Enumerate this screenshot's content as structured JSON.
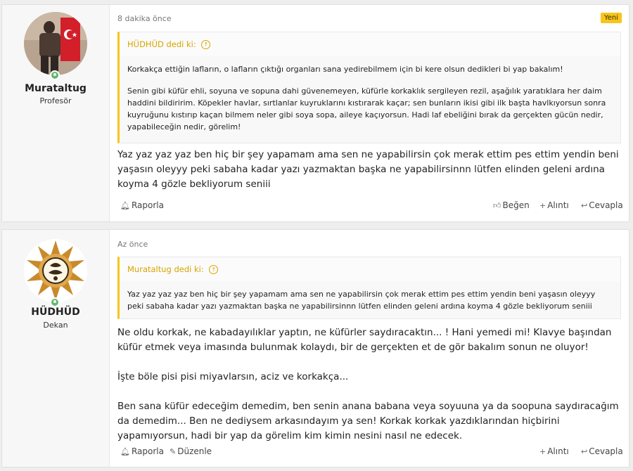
{
  "posts": [
    {
      "user": {
        "name": "Murataltug",
        "title": "Profesör",
        "avatar_icon": "avatar-flag-photo",
        "online": true
      },
      "time": "8 dakika önce",
      "badge": "Yeni",
      "quote": {
        "author": "HÜDHÜD dedi ki:",
        "paragraphs": [
          "Korkakça ettiğin lafların, o lafların çıktığı organları sana yedirebilmem için bi kere olsun dedikleri bi yap bakalım!",
          "Senin gibi küfür ehli, soyuna ve sopuna dahi güvenemeyen, küfürle korkaklık sergileyen rezil, aşağılık yaratıklara her daim haddini bildiririm. Köpekler havlar, sırtlanlar kuyruklarını kıstırarak kaçar; sen bunların ikisi gibi ilk başta havlkıyorsun sonra kuyruğunu kıstırıp kaçan bilmem neler gibi soya sopa, aileye kaçıyorsun. Hadi laf ebeliğini bırak da gerçekten gücün nedir, yapabileceğin nedir, görelim!"
        ]
      },
      "message": [
        "Yaz yaz yaz yaz ben hiç bir şey yapamam ama sen ne yapabilirsin çok merak ettim pes ettim yendin beni yaşasın oleyyy peki sabaha kadar yazı yazmaktan başka ne yapabilirsinnn lütfen elinden geleni ardına koyma 4 gözle bekliyorum seniii"
      ],
      "actions": {
        "report": "Raporla",
        "like": "Beğen",
        "quote": "Alıntı",
        "reply": "Cevapla"
      }
    },
    {
      "user": {
        "name": "HÜDHÜD",
        "title": "Dekan",
        "avatar_icon": "avatar-emblem",
        "online": true
      },
      "time": "Az önce",
      "quote": {
        "author": "Murataltug dedi ki:",
        "paragraphs": [
          "Yaz yaz yaz yaz ben hiç bir şey yapamam ama sen ne yapabilirsin çok merak ettim pes ettim yendin beni yaşasın oleyyy peki sabaha kadar yazı yazmaktan başka ne yapabilirsinnn lütfen elinden geleni ardına koyma 4 gözle bekliyorum seniii"
        ]
      },
      "message": [
        "Ne oldu korkak, ne kabadayılıklar yaptın, ne küfürler saydıracaktın... ! Hani yemedi mi! Klavye başından küfür etmek veya imasında bulunmak kolaydı, bir de gerçekten et de gör bakalım sonun ne oluyor!",
        "İşte böle pisi pisi miyavlarsın, aciz ve korkakça...",
        "Ben sana küfür edeceğim demedim, ben senin anana babana veya soyuuna ya da soopuna saydıracağım da demedim... Ben ne dediysem arkasındayım ya sen! Korkak korkak yazdıklarından hiçbirini yapamıyorsun, hadi bir yap da görelim kim kimin nesini nasıl ne edecek."
      ],
      "actions": {
        "report": "Raporla",
        "edit": "Düzenle",
        "quote": "Alıntı",
        "reply": "Cevapla"
      }
    }
  ],
  "colors": {
    "accent": "#f7c51b",
    "online": "#63b86d",
    "quote_author": "#d8a400"
  }
}
